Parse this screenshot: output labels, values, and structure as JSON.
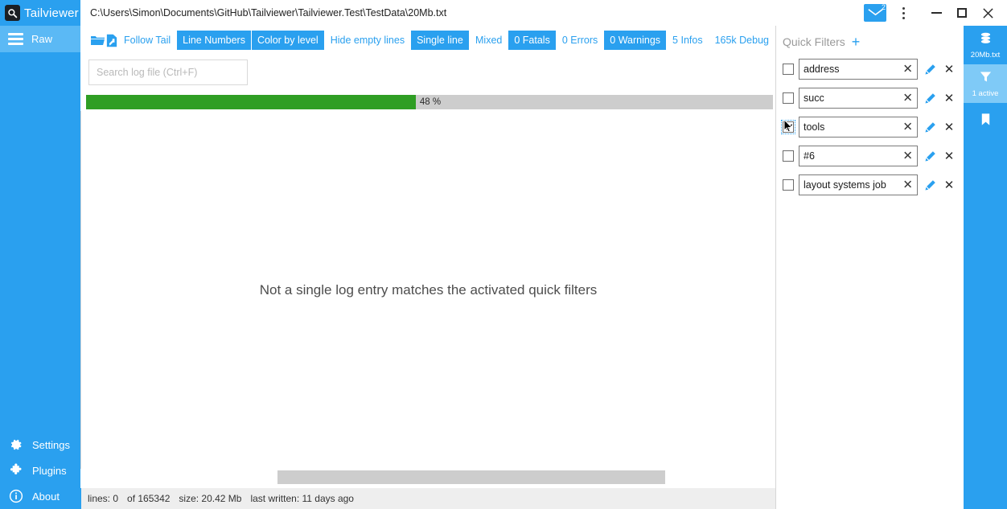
{
  "app": {
    "name": "Tailviewer",
    "logo_icon": "magnifier-icon",
    "title_path": "C:\\Users\\Simon\\Documents\\GitHub\\Tailviewer\\Tailviewer.Test\\TestData\\20Mb.txt",
    "accent": "#2aa0ef",
    "accent_light": "#5bb9f5",
    "progress_green": "#2f9e24"
  },
  "window_controls": {
    "mail_icon": "envelope-icon",
    "mail_badge": "2",
    "menu_icon": "kebab-menu-icon",
    "minimize": "minimize-icon",
    "maximize": "maximize-icon",
    "close": "close-icon",
    "close_glyph": "✕"
  },
  "sidebar": {
    "top_items": [
      {
        "label": "Raw",
        "icon": "hamburger-icon",
        "active": true
      }
    ],
    "bottom_items": [
      {
        "label": "Settings",
        "icon": "gear-icon"
      },
      {
        "label": "Plugins",
        "icon": "puzzle-icon"
      },
      {
        "label": "About",
        "icon": "info-icon"
      }
    ]
  },
  "toolbar": {
    "open_icon": "open-folder-icon",
    "add_icon": "add-file-icon",
    "buttons": [
      {
        "label": "Follow Tail",
        "active": false
      },
      {
        "label": "Line Numbers",
        "active": true
      },
      {
        "label": "Color by level",
        "active": true
      },
      {
        "label": "Hide empty lines",
        "active": false
      },
      {
        "label": "Single line",
        "active": true
      }
    ],
    "levels": [
      {
        "label": "Mixed",
        "active": false
      },
      {
        "label": "0 Fatals",
        "active": true
      },
      {
        "label": "0 Errors",
        "active": false
      },
      {
        "label": "0 Warnings",
        "active": true
      },
      {
        "label": "5 Infos",
        "active": false
      },
      {
        "label": "165k Debug",
        "active": false
      }
    ]
  },
  "search": {
    "placeholder": "Search log file (Ctrl+F)",
    "value": ""
  },
  "progress": {
    "percent": 48,
    "label": "48 %"
  },
  "content": {
    "empty_message": "Not a single log entry matches the activated quick filters"
  },
  "status_bar": {
    "lines": "lines: 0",
    "of": "of 165342",
    "size": "size: 20.42 Mb",
    "last_written": "last written: 11 days ago"
  },
  "quick_filters": {
    "title": "Quick Filters",
    "add_label": "+",
    "clear_glyph": "✕",
    "delete_glyph": "✕",
    "edit_icon": "pencil-icon",
    "rows": [
      {
        "value": "address",
        "checked": false
      },
      {
        "value": "succ",
        "checked": false
      },
      {
        "value": "tools",
        "checked": true
      },
      {
        "value": "#6",
        "checked": false
      },
      {
        "value": "layout systems job",
        "checked": false
      }
    ]
  },
  "right_rail": {
    "items": [
      {
        "label": "20Mb.txt",
        "icon": "data-source-icon",
        "active": false
      },
      {
        "label": "1 active",
        "icon": "funnel-icon",
        "active": true
      },
      {
        "label": "",
        "icon": "bookmark-icon",
        "active": false
      }
    ]
  }
}
